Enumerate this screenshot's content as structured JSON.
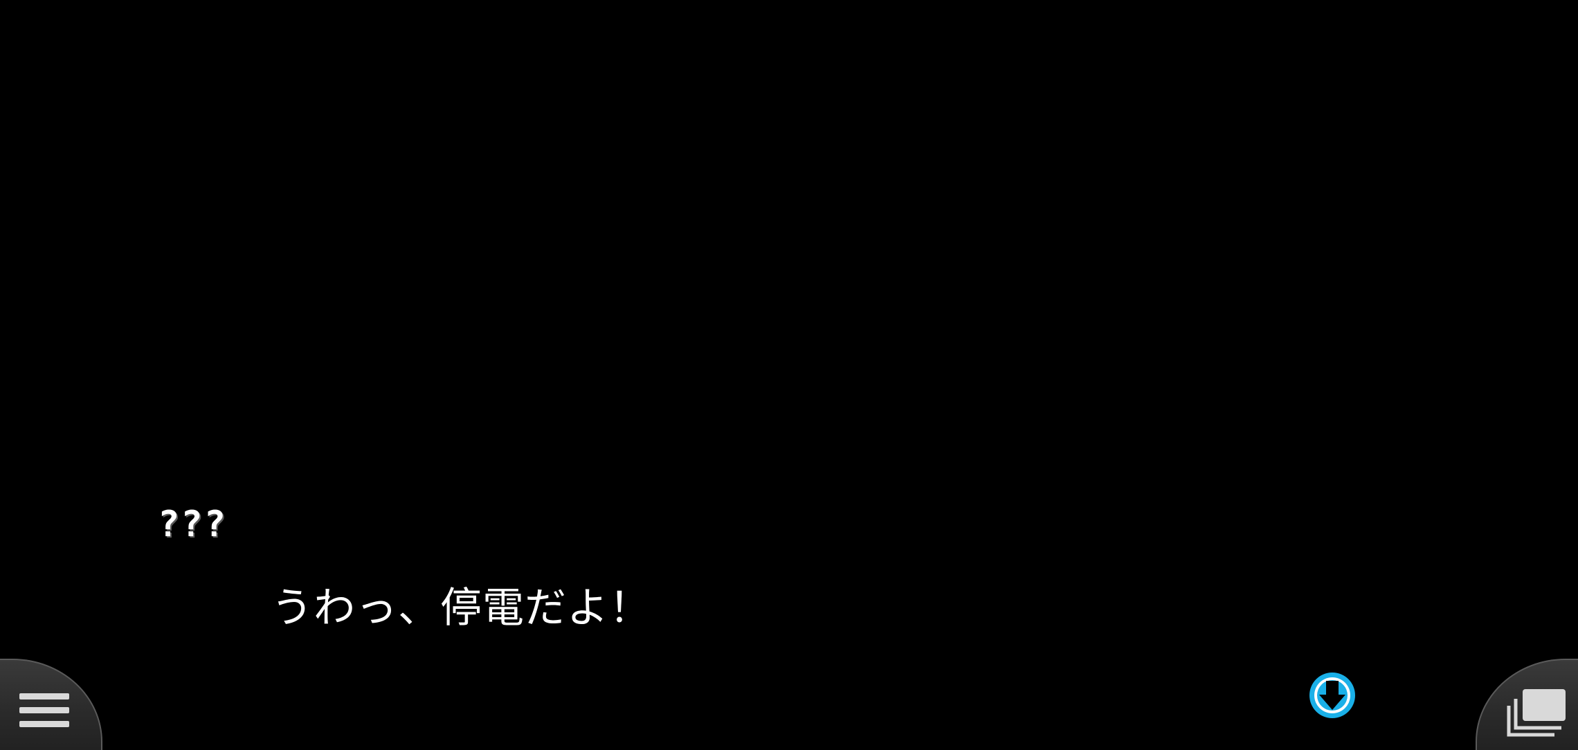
{
  "dialogue": {
    "speaker": "???",
    "text": "うわっ、停電だよ！"
  },
  "controls": {
    "menu_icon": "hamburger-menu-icon",
    "advance_icon": "arrow-down-icon",
    "log_icon": "stacked-windows-icon"
  },
  "colors": {
    "background": "#000000",
    "text": "#ffffff",
    "advance_indicator": "#1ab0e8",
    "button_bg": "#2f2f2f",
    "button_border": "#5a5a5a",
    "icon": "#d9d9d9"
  }
}
